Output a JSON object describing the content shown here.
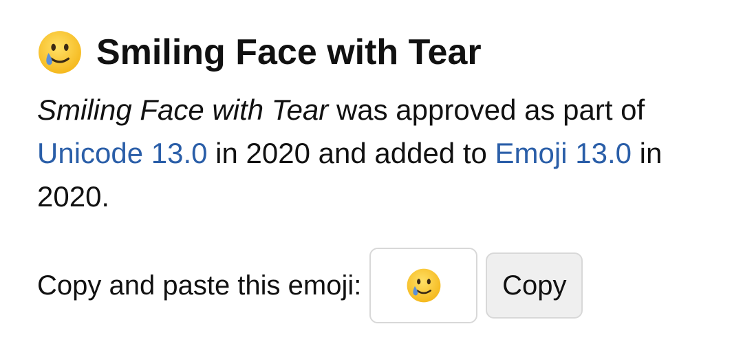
{
  "header": {
    "emoji_icon": "smiling-face-with-tear-icon",
    "title": "Smiling Face with Tear"
  },
  "description": {
    "emoji_name": "Smiling Face with Tear",
    "text_1": " was approved as part of ",
    "unicode_link": "Unicode 13.0",
    "text_2": " in 2020 and added to ",
    "emoji_version_link": "Emoji 13.0",
    "text_3": " in 2020."
  },
  "copy": {
    "label": "Copy and paste this emoji:",
    "emoji_value": "🥲",
    "button_label": "Copy"
  },
  "colors": {
    "link": "#2a5ea8",
    "face": "#ffcc33",
    "tear": "#5b8fd8",
    "button_bg": "#efefef",
    "border": "#d8d8d8"
  }
}
